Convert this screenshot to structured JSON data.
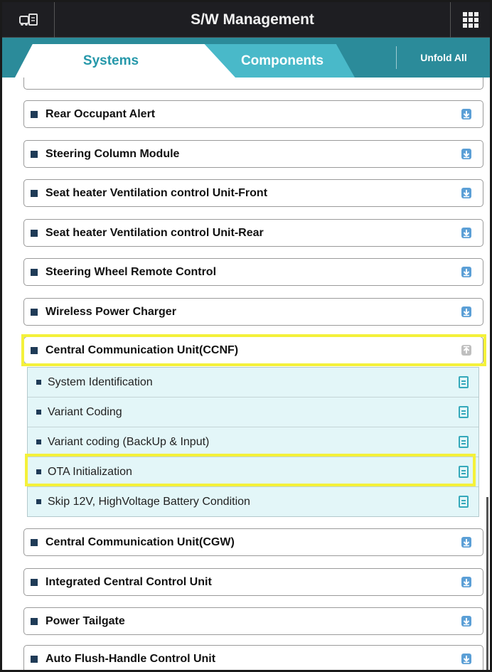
{
  "header": {
    "title": "S/W Management",
    "left_icon": "vehicle-diagnostics-icon",
    "right_icon": "grid-menu-icon",
    "background_color": "#1e1e22"
  },
  "tabs": {
    "items": [
      {
        "label": "Systems",
        "selected": true
      },
      {
        "label": "Components",
        "selected": false
      }
    ],
    "unfold_all_label": "Unfold All",
    "accent_color": "#2b8b9a"
  },
  "systems": [
    {
      "label": "Rear Occupant Alert",
      "expanded": false
    },
    {
      "label": "Steering Column Module",
      "expanded": false
    },
    {
      "label": "Seat heater Ventilation control Unit-Front",
      "expanded": false
    },
    {
      "label": "Seat heater Ventilation control Unit-Rear",
      "expanded": false
    },
    {
      "label": "Steering Wheel Remote Control",
      "expanded": false
    },
    {
      "label": "Wireless Power Charger",
      "expanded": false
    },
    {
      "label": "Central Communication Unit(CCNF)",
      "expanded": true,
      "highlighted": true,
      "sub_items": [
        {
          "label": "System Identification"
        },
        {
          "label": "Variant Coding"
        },
        {
          "label": "Variant coding (BackUp & Input)"
        },
        {
          "label": "OTA Initialization",
          "highlighted": true
        },
        {
          "label": "Skip 12V, HighVoltage Battery Condition"
        }
      ]
    },
    {
      "label": "Central Communication Unit(CGW)",
      "expanded": false
    },
    {
      "label": "Integrated Central Control Unit",
      "expanded": false
    },
    {
      "label": "Power Tailgate",
      "expanded": false
    },
    {
      "label": "Auto Flush-Handle Control Unit",
      "expanded": false
    }
  ],
  "highlight_color": "#f4f13a"
}
